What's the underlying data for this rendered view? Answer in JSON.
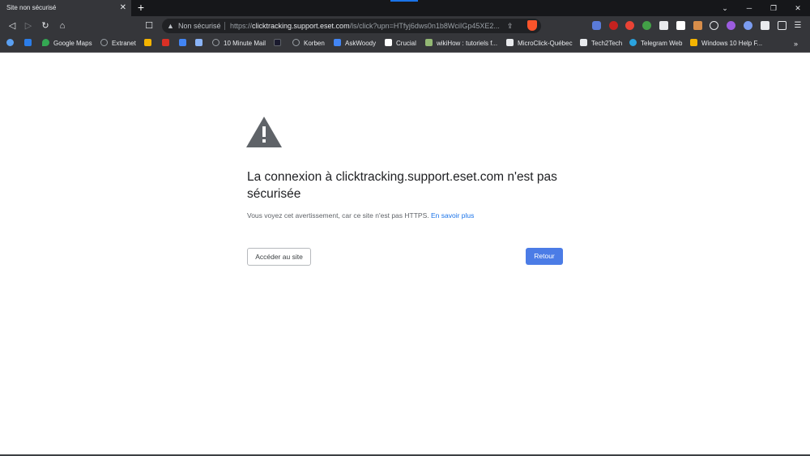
{
  "tab": {
    "title": "Site non sécurisé",
    "close": "✕",
    "new_tab": "+"
  },
  "window_controls": {
    "minimize": "⌄",
    "restore": "─",
    "maximize": "❐",
    "close": "✕"
  },
  "nav": {
    "back": "◁",
    "forward": "▷",
    "reload": "↻",
    "home": "⌂",
    "bookmark": "☐"
  },
  "omnibox": {
    "security_label": "Non sécurisé",
    "warning_glyph": "▲",
    "url_scheme": "https://",
    "url_host": "clicktracking.support.eset.com",
    "url_path": "/ls/click?upn=HTfyj6dws0n1b8WciIGp45XE2...",
    "share_glyph": "⇪"
  },
  "bookmarks": [
    {
      "label": "",
      "color": "#5aa0f2"
    },
    {
      "label": "",
      "color": "#2b7de9"
    },
    {
      "label": "Google Maps",
      "color": "#34a853"
    },
    {
      "label": "Extranet",
      "color": "#9aa0a6"
    },
    {
      "label": "",
      "color": "#f4b400"
    },
    {
      "label": "",
      "color": "#d93025"
    },
    {
      "label": "",
      "color": "#4285f4"
    },
    {
      "label": "",
      "color": "#8ab4f8"
    },
    {
      "label": "10 Minute Mail",
      "color": "#9aa0a6"
    },
    {
      "label": "",
      "color": "#1a1a2e"
    },
    {
      "label": "Korben",
      "color": "#9aa0a6"
    },
    {
      "label": "AskWoody",
      "color": "#4285f4"
    },
    {
      "label": "Crucial",
      "color": "#ffffff"
    },
    {
      "label": "wikiHow : tutoriels f...",
      "color": "#93b874"
    },
    {
      "label": "MicroClick-Québec",
      "color": "#e8eaed"
    },
    {
      "label": "Tech2Tech",
      "color": "#e8eaed"
    },
    {
      "label": "Telegram Web",
      "color": "#2aa3df"
    },
    {
      "label": "Windows 10 Help F...",
      "color": "#f4b400"
    }
  ],
  "bookmarks_overflow": "»",
  "page": {
    "title": "La connexion à clicktracking.support.eset.com n'est pas sécurisée",
    "description": "Vous voyez cet avertissement, car ce site n'est pas HTTPS.",
    "learn_more": "En savoir plus",
    "proceed_button": "Accéder au site",
    "back_button": "Retour"
  },
  "colors": {
    "accent": "#4b7ce6",
    "link": "#1a73e8",
    "warning_icon": "#5f6368"
  }
}
